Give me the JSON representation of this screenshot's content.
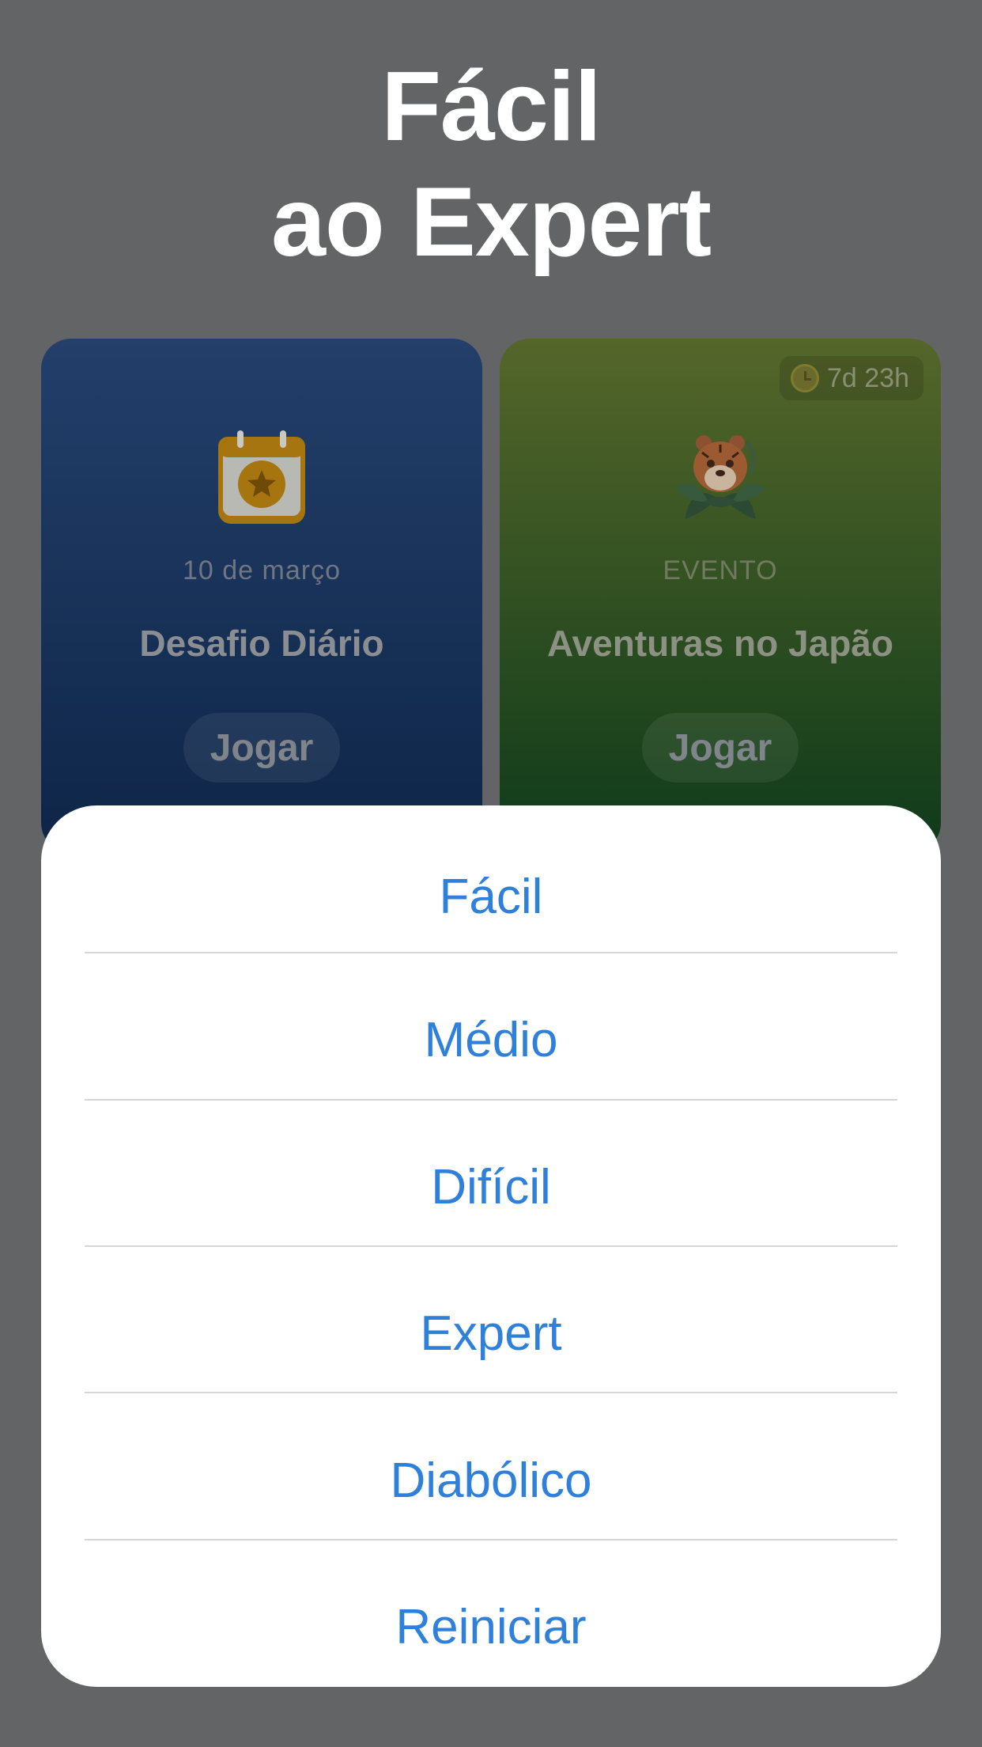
{
  "headline": {
    "line1": "Fácil",
    "line2": "ao Expert"
  },
  "cards": {
    "daily": {
      "icon": "calendar-star-icon",
      "subtitle": "10 de março",
      "title": "Desafio Diário",
      "play_label": "Jogar"
    },
    "event": {
      "icon": "tiger-icon",
      "timer_icon": "clock-icon",
      "timer": "7d 23h",
      "subtitle": "EVENTO",
      "title": "Aventuras no Japão",
      "play_label": "Jogar"
    }
  },
  "sheet": {
    "options": [
      {
        "label": "Fácil"
      },
      {
        "label": "Médio"
      },
      {
        "label": "Difícil"
      },
      {
        "label": "Expert"
      },
      {
        "label": "Diabólico"
      },
      {
        "label": "Reiniciar"
      }
    ]
  },
  "colors": {
    "overlay_background": "#636466",
    "option_text": "#2f80db",
    "sheet_background": "#ffffff"
  }
}
